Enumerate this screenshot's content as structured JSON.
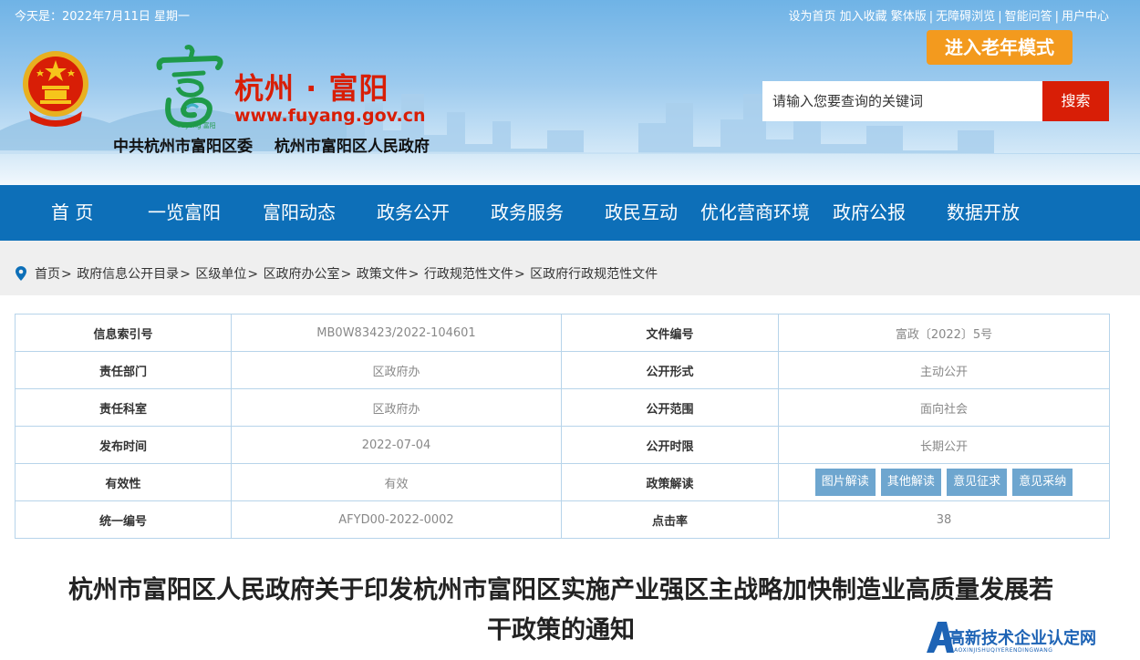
{
  "topbar": {
    "date": "今天是：2022年7月11日 星期一",
    "links": [
      "设为首页",
      "加入收藏",
      "繁体版",
      "无障碍浏览",
      "智能问答",
      "用户中心"
    ]
  },
  "header": {
    "elder_mode": "进入老年模式",
    "site_name": "杭州 · 富阳",
    "site_url": "www.fuyang.gov.cn",
    "org_party": "中共杭州市富阳区委",
    "org_gov": "杭州市富阳区人民政府",
    "logo_caption": "Fuyang 富阳",
    "search": {
      "placeholder": "请输入您要查询的关键词",
      "button": "搜索"
    }
  },
  "nav": [
    "首 页",
    "一览富阳",
    "富阳动态",
    "政务公开",
    "政务服务",
    "政民互动",
    "优化营商环境",
    "政府公报",
    "数据开放"
  ],
  "breadcrumb": [
    "首页",
    "政府信息公开目录",
    "区级单位",
    "区政府办公室",
    "政策文件",
    "行政规范性文件",
    "区政府行政规范性文件"
  ],
  "info_table": [
    {
      "k1": "信息索引号",
      "v1": "MB0W83423/2022-104601",
      "k2": "文件编号",
      "v2": "富政〔2022〕5号"
    },
    {
      "k1": "责任部门",
      "v1": "区政府办",
      "k2": "公开形式",
      "v2": "主动公开"
    },
    {
      "k1": "责任科室",
      "v1": "区政府办",
      "k2": "公开范围",
      "v2": "面向社会"
    },
    {
      "k1": "发布时间",
      "v1": "2022-07-04",
      "k2": "公开时限",
      "v2": "长期公开"
    },
    {
      "k1": "有效性",
      "v1": "有效",
      "k2": "政策解读",
      "tags": [
        "图片解读",
        "其他解读",
        "意见征求",
        "意见采纳"
      ]
    },
    {
      "k1": "统一编号",
      "v1": "AFYD00-2022-0002",
      "k2": "点击率",
      "v2": "38"
    }
  ],
  "doc_title_line1": "杭州市富阳区人民政府关于印发杭州市富阳区实施产业强区主战略加快制造业高质量发展若",
  "doc_title_line2": "干政策的通知",
  "watermark": {
    "text": "高新技术企业认定网",
    "sub": "GAOXINJISHUQIYERENDINGWANG"
  },
  "colors": {
    "nav_bg": "#0d6fb8",
    "accent_red": "#d81e06",
    "elder_orange": "#f39a1e",
    "tag_blue": "#6ea6cf"
  }
}
